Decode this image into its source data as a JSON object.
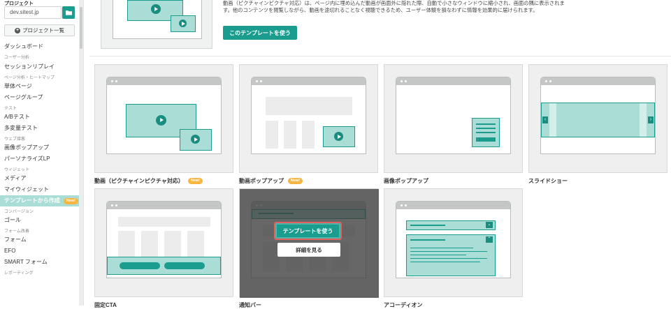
{
  "sidebar": {
    "project_label": "プロジェクト",
    "domain": "dev.sitest.jp",
    "project_list_button": "プロジェクト一覧",
    "nav": [
      {
        "type": "item",
        "label": "ダッシュボード"
      },
      {
        "type": "head",
        "label": "ユーザー分析"
      },
      {
        "type": "item",
        "label": "セッションリプレイ"
      },
      {
        "type": "head",
        "label": "ページ分析・ヒートマップ"
      },
      {
        "type": "item",
        "label": "単体ページ"
      },
      {
        "type": "item",
        "label": "ページグループ"
      },
      {
        "type": "head",
        "label": "テスト"
      },
      {
        "type": "item",
        "label": "A/Bテスト"
      },
      {
        "type": "item",
        "label": "多変量テスト"
      },
      {
        "type": "head",
        "label": "ウェブ接客"
      },
      {
        "type": "item",
        "label": "画像ポップアップ"
      },
      {
        "type": "item",
        "label": "パーソナライズLP"
      },
      {
        "type": "head",
        "label": "ウィジェット"
      },
      {
        "type": "item",
        "label": "メディア"
      },
      {
        "type": "item",
        "label": "マイウィジェット"
      },
      {
        "type": "active",
        "label": "テンプレートから作成",
        "badge": "New!"
      },
      {
        "type": "head",
        "label": "コンバージョン"
      },
      {
        "type": "item",
        "label": "ゴール"
      },
      {
        "type": "head",
        "label": "フォーム改善"
      },
      {
        "type": "item",
        "label": "フォーム"
      },
      {
        "type": "item",
        "label": "EFO"
      },
      {
        "type": "item",
        "label": "SMART フォーム"
      },
      {
        "type": "head",
        "label": "レポーティング"
      }
    ]
  },
  "main": {
    "top_description": "動画（ピクチャインピクチャ対応）は、ページ内に埋め込んだ動画が画面外に隠れた際、自動で小さなウィンドウに縮小され、画面の隅に表示されます。他のコンテンツを閲覧しながら、動画を途切れることなく視聴できるため、ユーザー体験を損なわずに情報を効果的に届けられます。",
    "use_template_button": "このテンプレートを使う",
    "templates": [
      {
        "label": "動画（ピクチャインピクチャ対応）",
        "badge": "New!"
      },
      {
        "label": "動画ポップアップ",
        "badge": "New!"
      },
      {
        "label": "画像ポップアップ",
        "badge": ""
      },
      {
        "label": "スライドショー",
        "badge": ""
      },
      {
        "label": "固定CTA",
        "badge": ""
      },
      {
        "label": "通知バー",
        "badge": ""
      },
      {
        "label": "アコーディオン",
        "badge": ""
      }
    ],
    "hover_use_button": "テンプレートを使う",
    "hover_detail_button": "詳細を見る"
  },
  "colors": {
    "accent": "#1a9d8f",
    "accent_light": "#a9ddd6",
    "badge": "#f5b642",
    "highlight": "#e26060"
  }
}
